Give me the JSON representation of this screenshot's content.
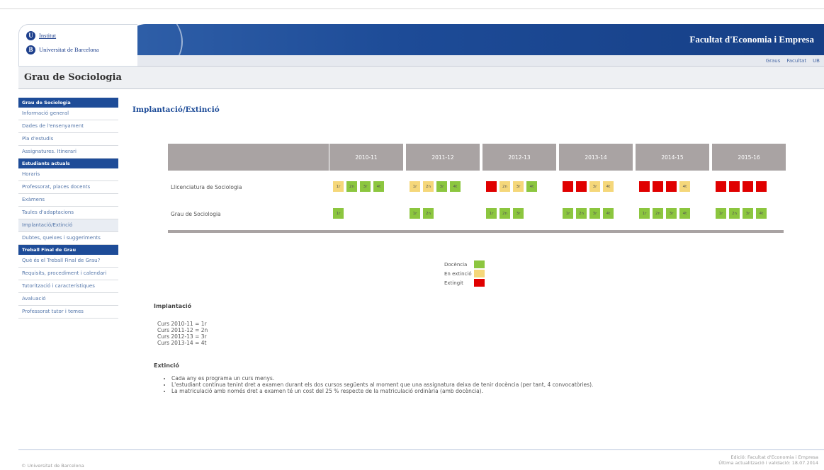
{
  "header": {
    "logo_line1": "Institut",
    "logo_line2": "Universitat de Barcelona",
    "logo_mark_1": "U",
    "logo_mark_2": "B",
    "faculty": "Facultat d'Economia i Empresa",
    "links": [
      "Graus",
      "Facultat",
      "UB"
    ]
  },
  "page_title": "Grau de Sociologia",
  "sidebar": [
    {
      "type": "head",
      "label": "Grau de Sociologia"
    },
    {
      "type": "item",
      "label": "Informació general"
    },
    {
      "type": "item",
      "label": "Dades de l'ensenyament"
    },
    {
      "type": "item",
      "label": "Pla d'estudis"
    },
    {
      "type": "item",
      "label": "Assignatures. Itinerari"
    },
    {
      "type": "head",
      "label": "Estudiants actuals"
    },
    {
      "type": "item",
      "label": "Horaris"
    },
    {
      "type": "item",
      "label": "Professorat, places docents"
    },
    {
      "type": "item",
      "label": "Exàmens"
    },
    {
      "type": "item",
      "label": "Taules d'adaptacions"
    },
    {
      "type": "item",
      "label": "Implantació/Extinció",
      "active": true
    },
    {
      "type": "item",
      "label": "Dubtes, queixes i suggeriments"
    },
    {
      "type": "head",
      "label": "Treball Final de Grau"
    },
    {
      "type": "item",
      "label": "Què és el Treball Final de Grau?"
    },
    {
      "type": "item",
      "label": "Requisits, procediment i calendari"
    },
    {
      "type": "item",
      "label": "Tutorització i característiques"
    },
    {
      "type": "item",
      "label": "Avaluació"
    },
    {
      "type": "item",
      "label": "Professorat tutor i temes"
    }
  ],
  "main": {
    "title": "Implantació/Extinció",
    "years": [
      "2010-11",
      "2011-12",
      "2012-13",
      "2013-14",
      "2014-15",
      "2015-16"
    ],
    "rows": [
      {
        "label": "Llicenciatura de Sociologia",
        "years": [
          [
            {
              "t": "1r",
              "s": "ext"
            },
            {
              "t": "2n",
              "s": "doc"
            },
            {
              "t": "3r",
              "s": "doc"
            },
            {
              "t": "4t",
              "s": "doc"
            }
          ],
          [
            {
              "t": "1r",
              "s": "ext"
            },
            {
              "t": "2n",
              "s": "ext"
            },
            {
              "t": "3r",
              "s": "doc"
            },
            {
              "t": "4t",
              "s": "doc"
            }
          ],
          [
            {
              "t": "",
              "s": "off"
            },
            {
              "t": "2n",
              "s": "ext"
            },
            {
              "t": "3r",
              "s": "ext"
            },
            {
              "t": "4t",
              "s": "doc"
            }
          ],
          [
            {
              "t": "",
              "s": "off"
            },
            {
              "t": "",
              "s": "off"
            },
            {
              "t": "3r",
              "s": "ext"
            },
            {
              "t": "4t",
              "s": "ext"
            }
          ],
          [
            {
              "t": "",
              "s": "off"
            },
            {
              "t": "",
              "s": "off"
            },
            {
              "t": "",
              "s": "off"
            },
            {
              "t": "4t",
              "s": "ext"
            }
          ],
          [
            {
              "t": "",
              "s": "off"
            },
            {
              "t": "",
              "s": "off"
            },
            {
              "t": "",
              "s": "off"
            },
            {
              "t": "",
              "s": "off"
            }
          ]
        ]
      },
      {
        "label": "Grau de Sociologia",
        "years": [
          [
            {
              "t": "1r",
              "s": "doc"
            }
          ],
          [
            {
              "t": "1r",
              "s": "doc"
            },
            {
              "t": "2n",
              "s": "doc"
            }
          ],
          [
            {
              "t": "1r",
              "s": "doc"
            },
            {
              "t": "2n",
              "s": "doc"
            },
            {
              "t": "3r",
              "s": "doc"
            }
          ],
          [
            {
              "t": "1r",
              "s": "doc"
            },
            {
              "t": "2n",
              "s": "doc"
            },
            {
              "t": "3r",
              "s": "doc"
            },
            {
              "t": "4t",
              "s": "doc"
            }
          ],
          [
            {
              "t": "1r",
              "s": "doc"
            },
            {
              "t": "2n",
              "s": "doc"
            },
            {
              "t": "3r",
              "s": "doc"
            },
            {
              "t": "4t",
              "s": "doc"
            }
          ],
          [
            {
              "t": "1r",
              "s": "doc"
            },
            {
              "t": "2n",
              "s": "doc"
            },
            {
              "t": "3r",
              "s": "doc"
            },
            {
              "t": "4t",
              "s": "doc"
            }
          ]
        ]
      }
    ],
    "colors": {
      "doc": "#8cc63f",
      "ext": "#f5d77a",
      "off": "#e00000",
      "head": "#a9a3a3"
    },
    "legend": [
      {
        "label": "Docència",
        "s": "doc"
      },
      {
        "label": "En extinció",
        "s": "ext"
      },
      {
        "label": "Extingit",
        "s": "off"
      }
    ],
    "implantacio_title": "Implantació",
    "implantacio": [
      "Curs 2010-11 = 1r",
      "Curs 2011-12 = 2n",
      "Curs 2012-13 = 3r",
      "Curs 2013-14 = 4t"
    ],
    "extincio_title": "Extinció",
    "extincio": [
      "Cada any es programa un curs menys.",
      "L'estudiant continua tenint dret a examen durant els dos cursos següents al moment que una assignatura deixa de tenir docència (per tant, 4 convocatòries).",
      "La matriculació amb només dret a examen té un cost del 25 % respecte de la matriculació ordinària (amb docència)."
    ]
  },
  "footer": {
    "left": "© Universitat de Barcelona",
    "right1": "Edició: Facultat d'Economia i Empresa",
    "right2": "Última actualització i validació: 18.07.2014"
  }
}
